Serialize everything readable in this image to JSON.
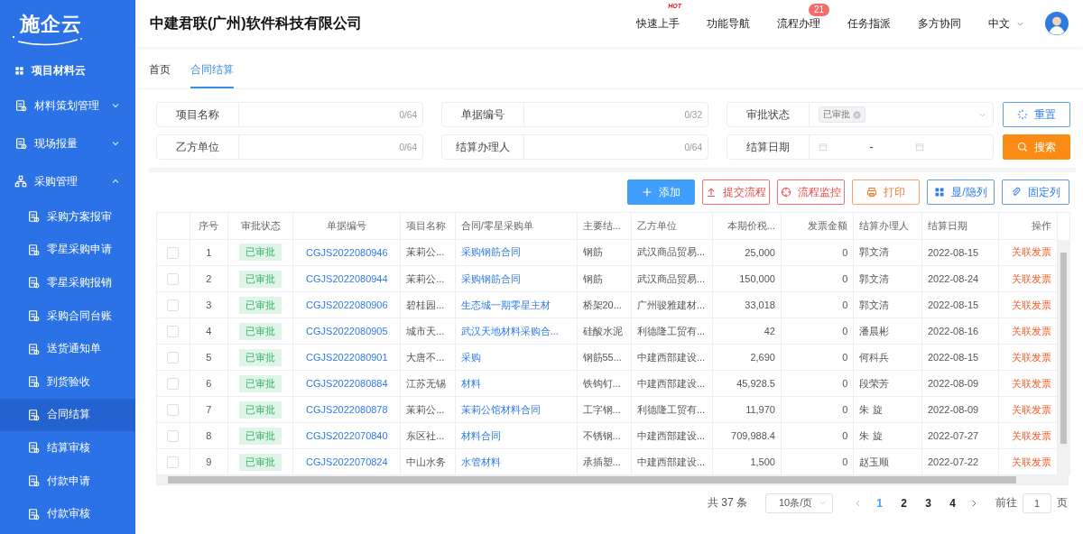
{
  "brand": {
    "name": "施企云"
  },
  "company": "中建君联(广州)软件科技有限公司",
  "top_nav": [
    {
      "label": "快速上手",
      "tag": "HOT"
    },
    {
      "label": "功能导航"
    },
    {
      "label": "流程办理",
      "badge": "21"
    },
    {
      "label": "任务指派"
    },
    {
      "label": "多方协同"
    }
  ],
  "language": "中文",
  "sidebar": {
    "items": [
      {
        "label": "项目材料云",
        "kind": "home"
      },
      {
        "label": "材料策划管理",
        "kind": "menu",
        "expanded": false
      },
      {
        "label": "现场报量",
        "kind": "menu",
        "expanded": false
      },
      {
        "label": "采购管理",
        "kind": "menu",
        "expanded": true,
        "children": [
          {
            "label": "采购方案报审",
            "selected": false
          },
          {
            "label": "零星采购申请",
            "selected": false
          },
          {
            "label": "零星采购报销",
            "selected": false
          },
          {
            "label": "采购合同台账",
            "selected": false
          },
          {
            "label": "送货通知单",
            "selected": false
          },
          {
            "label": "到货验收",
            "selected": false
          },
          {
            "label": "合同结算",
            "selected": true
          },
          {
            "label": "结算审核",
            "selected": false
          },
          {
            "label": "付款申请",
            "selected": false
          },
          {
            "label": "付款审核",
            "selected": false
          }
        ]
      }
    ]
  },
  "tabs": [
    {
      "label": "首页",
      "selected": false
    },
    {
      "label": "合同结算",
      "selected": true
    }
  ],
  "filters": [
    {
      "label": "项目名称",
      "kind": "text",
      "counter": "0/64"
    },
    {
      "label": "单据编号",
      "kind": "text",
      "counter": "0/32"
    },
    {
      "label": "审批状态",
      "kind": "select",
      "tags": [
        "已审批"
      ]
    },
    {
      "label": "乙方单位",
      "kind": "text",
      "counter": "0/64"
    },
    {
      "label": "结算办理人",
      "kind": "text",
      "counter": "0/64"
    },
    {
      "label": "结算日期",
      "kind": "daterange",
      "separator": "-"
    }
  ],
  "filter_buttons": [
    {
      "label": "重置",
      "kind": "reset"
    },
    {
      "label": "搜索",
      "kind": "search"
    }
  ],
  "toolbar": [
    {
      "label": "添加",
      "kind": "add"
    },
    {
      "label": "提交流程",
      "kind": "submit"
    },
    {
      "label": "流程监控",
      "kind": "monitor"
    },
    {
      "label": "打印",
      "kind": "print"
    },
    {
      "label": "显/隐列",
      "kind": "columns"
    },
    {
      "label": "固定列",
      "kind": "pin"
    }
  ],
  "table": {
    "columns": [
      "序号",
      "审批状态",
      "单据编号",
      "项目名称",
      "合同/零星采购单",
      "主要结...",
      "乙方单位",
      "本期价税...",
      "发票金额",
      "结算办理人",
      "结算日期",
      "操作"
    ],
    "rows": [
      {
        "checked": false,
        "cells": [
          "1",
          "已审批",
          "CGJS2022080946",
          "茉莉公...",
          "采购钢筋合同",
          "钢筋",
          "武汉商品贸易...",
          "25,000",
          "0",
          "郭文清",
          "2022-08-15",
          "关联发票"
        ]
      },
      {
        "checked": false,
        "cells": [
          "2",
          "已审批",
          "CGJS2022080944",
          "茉莉公...",
          "采购钢筋合同",
          "钢筋",
          "武汉商品贸易...",
          "150,000",
          "0",
          "郭文清",
          "2022-08-24",
          "关联发票"
        ]
      },
      {
        "checked": false,
        "cells": [
          "3",
          "已审批",
          "CGJS2022080906",
          "碧桂园...",
          "生态城一期零星主材",
          "桥架20...",
          "广州骏雅建材...",
          "33,018",
          "0",
          "郭文清",
          "2022-08-15",
          "关联发票"
        ]
      },
      {
        "checked": false,
        "cells": [
          "4",
          "已审批",
          "CGJS2022080905",
          "城市天...",
          "武汉天地材料采购合...",
          "硅酸水泥",
          "利德隆工贸有...",
          "42",
          "0",
          "潘晨彬",
          "2022-08-16",
          "关联发票"
        ]
      },
      {
        "checked": false,
        "cells": [
          "5",
          "已审批",
          "CGJS2022080901",
          "大唐不...",
          "采购",
          "钢筋55...",
          "中建西部建设...",
          "2,690",
          "0",
          "何科兵",
          "2022-08-15",
          "关联发票"
        ]
      },
      {
        "checked": false,
        "cells": [
          "6",
          "已审批",
          "CGJS2022080884",
          "江苏无锡",
          "材料",
          "铁钩钉...",
          "中建西部建设...",
          "45,928.5",
          "0",
          "段荣芳",
          "2022-08-09",
          "关联发票"
        ]
      },
      {
        "checked": false,
        "cells": [
          "7",
          "已审批",
          "CGJS2022080878",
          "茉莉公...",
          "茉莉公馆材料合同",
          "工字钢...",
          "利德隆工贸有...",
          "11,970",
          "0",
          "朱 旋",
          "2022-08-09",
          "关联发票"
        ]
      },
      {
        "checked": false,
        "cells": [
          "8",
          "已审批",
          "CGJS2022070840",
          "东区社...",
          "材料合同",
          "不锈钢...",
          "中建西部建设...",
          "709,988.4",
          "0",
          "朱 旋",
          "2022-07-27",
          "关联发票"
        ]
      },
      {
        "checked": false,
        "cells": [
          "9",
          "已审批",
          "CGJS2022070824",
          "中山水务",
          "水管材料",
          "承插塑...",
          "中建西部建设...",
          "1,500",
          "0",
          "赵玉顺",
          "2022-07-22",
          "关联发票"
        ]
      }
    ]
  },
  "pagination": {
    "total": "共 37 条",
    "page_size": "10条/页",
    "pages": [
      {
        "label": "1",
        "selected": true
      },
      {
        "label": "2",
        "selected": false
      },
      {
        "label": "3",
        "selected": false
      },
      {
        "label": "4",
        "selected": false
      }
    ],
    "goto_label": "前往",
    "goto_value": "1",
    "page_suffix": "页"
  }
}
